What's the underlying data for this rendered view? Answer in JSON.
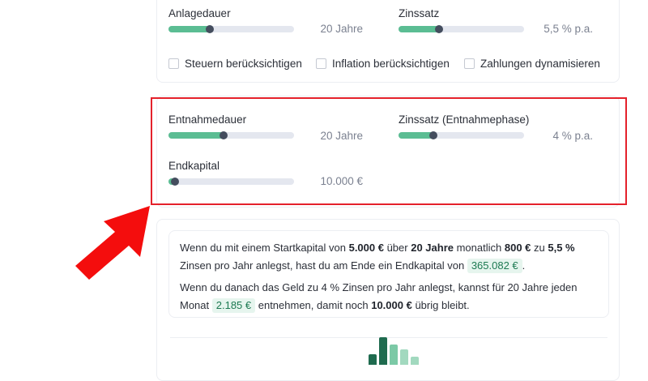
{
  "savings": {
    "duration": {
      "label": "Anlagedauer",
      "value": "20 Jahre",
      "fraction": 0.33
    },
    "rate": {
      "label": "Zinssatz",
      "value": "5,5 % p.a.",
      "fraction": 0.32
    },
    "options": [
      {
        "label": "Steuern berücksichtigen",
        "checked": false
      },
      {
        "label": "Inflation berücksichtigen",
        "checked": false
      },
      {
        "label": "Zahlungen dynamisieren",
        "checked": false
      }
    ]
  },
  "withdrawal": {
    "duration": {
      "label": "Entnahmedauer",
      "value": "20 Jahre",
      "fraction": 0.44
    },
    "rate": {
      "label": "Zinssatz (Entnahmephase)",
      "value": "4 % p.a.",
      "fraction": 0.28
    },
    "end_capital": {
      "label": "Endkapital",
      "value": "10.000 €",
      "fraction": 0.05
    }
  },
  "summary": {
    "p1": {
      "t1": "Wenn du mit einem Startkapital von ",
      "start_capital": "5.000 €",
      "t2": " über ",
      "years": "20 Jahre",
      "t3": " monatlich ",
      "monthly": "800 €",
      "t4": " zu ",
      "rate": "5,5 %",
      "t5": " Zinsen pro Jahr anlegst, hast du am Ende ein Endkapital von ",
      "end_capital": "365.082 €",
      "t6": "."
    },
    "p2": {
      "t1": "Wenn du danach das Geld zu 4 % Zinsen pro Jahr anlegst, kannst für 20 Jahre jeden Monat ",
      "monthly_withdrawal": "2.185 €",
      "t2": " entnehmen, damit noch ",
      "remaining": "10.000 €",
      "t3": " übrig bleibt."
    }
  },
  "colors": {
    "accent": "#5bbd93",
    "thumb": "#444d5e",
    "highlight": "#e4212b",
    "arrow": "#f40d0d"
  }
}
